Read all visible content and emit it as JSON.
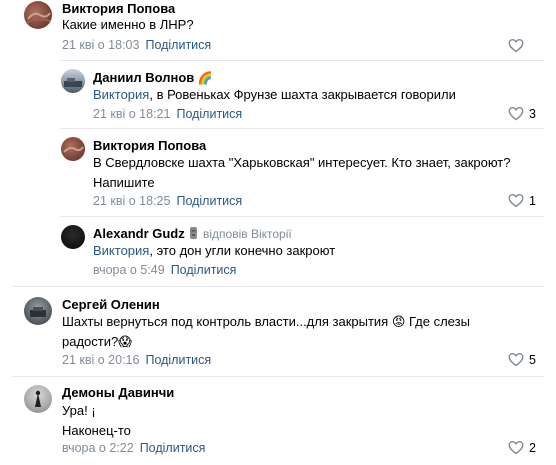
{
  "comments": [
    {
      "author": "Виктория Попова",
      "text": "Какие именно в ЛНР?",
      "time": "21 кві о 18:03",
      "share_label": "Поділитися",
      "likes": ""
    },
    {
      "author": "Даниил Волнов",
      "author_emoji": "🌈",
      "mention": "Виктория",
      "text": ", в Ровеньках Фрунзе шахта закрывается говорили",
      "time": "21 кві о 18:21",
      "share_label": "Поділитися",
      "likes": "3"
    },
    {
      "author": "Виктория Попова",
      "text_line1": "В Свердловске шахта \"Харьковская\" интересует. Кто знает, закроют?",
      "text_line2": "Напишите",
      "time": "21 кві о 18:25",
      "share_label": "Поділитися",
      "likes": "1"
    },
    {
      "author": "Alexandr Gudz",
      "replied_to": "відповів Вікторії",
      "mention": "Виктория",
      "text": ", это дон угли конечно закроют",
      "time": "вчора о 5:49",
      "share_label": "Поділитися",
      "likes": ""
    },
    {
      "author": "Сергей Оленин",
      "text_line1": "Шахты вернуться под контроль власти...для закрытия 😡 Где слезы",
      "text_line2": "радости?😱",
      "time": "21 кві о 20:16",
      "share_label": "Поділитися",
      "likes": "5"
    },
    {
      "author": "Демоны Давинчи",
      "text_line1": "Ура! ¡",
      "text_line2": "Наконец-то",
      "time": "вчора о 2:22",
      "share_label": "Поділитися",
      "likes": "2"
    }
  ],
  "colors": {
    "link": "#2a5885",
    "meta": "#818c99",
    "divider": "#e7e8ec"
  }
}
